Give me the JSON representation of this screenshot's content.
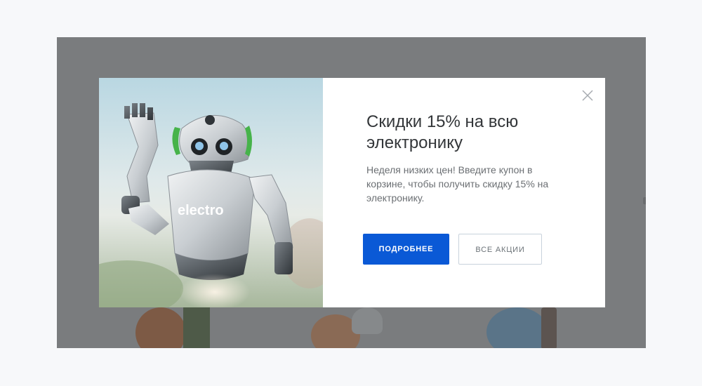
{
  "promo": {
    "title": "Скидки 15% на всю электронику",
    "description": "Неделя низких цен! Введите купон в корзине, чтобы получить скидку 15% на электронику.",
    "primary_button": "ПОДРОБНЕЕ",
    "secondary_button": "ВСЕ АКЦИИ",
    "robot_chest_text": "electro"
  },
  "colors": {
    "primary": "#0a59d6",
    "overlay": "#7a7c7e",
    "accent_green": "#46b34a"
  },
  "icons": {
    "close": "close-icon"
  }
}
